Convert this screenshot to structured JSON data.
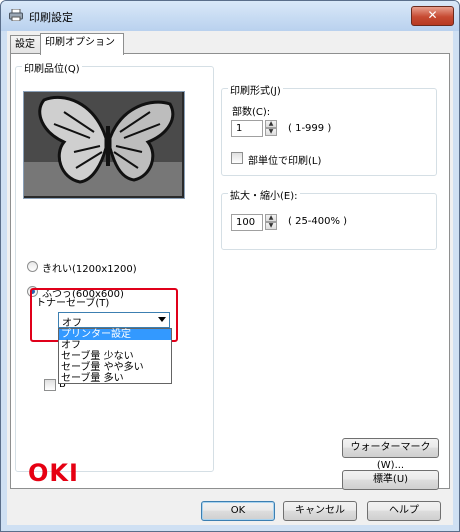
{
  "window": {
    "title": "印刷設定",
    "close_symbol": "✕"
  },
  "tabs": [
    {
      "label": "設定"
    },
    {
      "label": "印刷オプション"
    }
  ],
  "print_quality": {
    "title": "印刷品位(Q)",
    "options": [
      {
        "label": "きれい(1200x1200)",
        "selected": false
      },
      {
        "label": "ふつう(600x600)",
        "selected": true
      }
    ]
  },
  "print_format": {
    "title": "印刷形式(J)",
    "copies_label": "部数(C):",
    "copies_value": "1",
    "copies_range": "( 1-999 )",
    "collate_label": "部単位で印刷(L)"
  },
  "zoom": {
    "title": "拡大・縮小(E):",
    "value": "100",
    "range": "( 25-400% )"
  },
  "toner_save": {
    "label": "トナーセーブ(T)",
    "selected_value": "オフ",
    "options": [
      "プリンター設定",
      "オフ",
      "セーブ量 少ない",
      "セーブ量 やや多い",
      "セーブ量 多い"
    ],
    "highlighted_index": 0
  },
  "hidden_checkbox_letter": "B",
  "buttons": {
    "watermark": "ウォーターマーク(W)...",
    "default": "標準(U)",
    "ok": "OK",
    "cancel": "キャンセル",
    "help": "ヘルプ"
  },
  "brand": {
    "logo_text": "OKI",
    "color": "#e60012"
  },
  "colors": {
    "accent": "#3399ff",
    "highlight_box": "#e0001a"
  }
}
